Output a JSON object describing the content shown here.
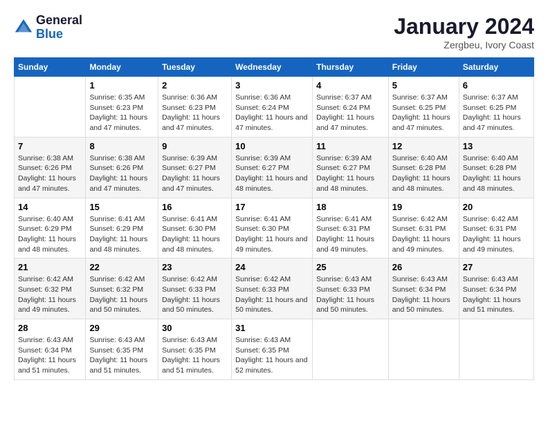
{
  "logo": {
    "line1": "General",
    "line2": "Blue"
  },
  "title": "January 2024",
  "subtitle": "Zergbeu, Ivory Coast",
  "days_of_week": [
    "Sunday",
    "Monday",
    "Tuesday",
    "Wednesday",
    "Thursday",
    "Friday",
    "Saturday"
  ],
  "weeks": [
    [
      {
        "day": "",
        "sunrise": "",
        "sunset": "",
        "daylight": ""
      },
      {
        "day": "1",
        "sunrise": "Sunrise: 6:35 AM",
        "sunset": "Sunset: 6:23 PM",
        "daylight": "Daylight: 11 hours and 47 minutes."
      },
      {
        "day": "2",
        "sunrise": "Sunrise: 6:36 AM",
        "sunset": "Sunset: 6:23 PM",
        "daylight": "Daylight: 11 hours and 47 minutes."
      },
      {
        "day": "3",
        "sunrise": "Sunrise: 6:36 AM",
        "sunset": "Sunset: 6:24 PM",
        "daylight": "Daylight: 11 hours and 47 minutes."
      },
      {
        "day": "4",
        "sunrise": "Sunrise: 6:37 AM",
        "sunset": "Sunset: 6:24 PM",
        "daylight": "Daylight: 11 hours and 47 minutes."
      },
      {
        "day": "5",
        "sunrise": "Sunrise: 6:37 AM",
        "sunset": "Sunset: 6:25 PM",
        "daylight": "Daylight: 11 hours and 47 minutes."
      },
      {
        "day": "6",
        "sunrise": "Sunrise: 6:37 AM",
        "sunset": "Sunset: 6:25 PM",
        "daylight": "Daylight: 11 hours and 47 minutes."
      }
    ],
    [
      {
        "day": "7",
        "sunrise": "Sunrise: 6:38 AM",
        "sunset": "Sunset: 6:26 PM",
        "daylight": "Daylight: 11 hours and 47 minutes."
      },
      {
        "day": "8",
        "sunrise": "Sunrise: 6:38 AM",
        "sunset": "Sunset: 6:26 PM",
        "daylight": "Daylight: 11 hours and 47 minutes."
      },
      {
        "day": "9",
        "sunrise": "Sunrise: 6:39 AM",
        "sunset": "Sunset: 6:27 PM",
        "daylight": "Daylight: 11 hours and 47 minutes."
      },
      {
        "day": "10",
        "sunrise": "Sunrise: 6:39 AM",
        "sunset": "Sunset: 6:27 PM",
        "daylight": "Daylight: 11 hours and 48 minutes."
      },
      {
        "day": "11",
        "sunrise": "Sunrise: 6:39 AM",
        "sunset": "Sunset: 6:27 PM",
        "daylight": "Daylight: 11 hours and 48 minutes."
      },
      {
        "day": "12",
        "sunrise": "Sunrise: 6:40 AM",
        "sunset": "Sunset: 6:28 PM",
        "daylight": "Daylight: 11 hours and 48 minutes."
      },
      {
        "day": "13",
        "sunrise": "Sunrise: 6:40 AM",
        "sunset": "Sunset: 6:28 PM",
        "daylight": "Daylight: 11 hours and 48 minutes."
      }
    ],
    [
      {
        "day": "14",
        "sunrise": "Sunrise: 6:40 AM",
        "sunset": "Sunset: 6:29 PM",
        "daylight": "Daylight: 11 hours and 48 minutes."
      },
      {
        "day": "15",
        "sunrise": "Sunrise: 6:41 AM",
        "sunset": "Sunset: 6:29 PM",
        "daylight": "Daylight: 11 hours and 48 minutes."
      },
      {
        "day": "16",
        "sunrise": "Sunrise: 6:41 AM",
        "sunset": "Sunset: 6:30 PM",
        "daylight": "Daylight: 11 hours and 48 minutes."
      },
      {
        "day": "17",
        "sunrise": "Sunrise: 6:41 AM",
        "sunset": "Sunset: 6:30 PM",
        "daylight": "Daylight: 11 hours and 49 minutes."
      },
      {
        "day": "18",
        "sunrise": "Sunrise: 6:41 AM",
        "sunset": "Sunset: 6:31 PM",
        "daylight": "Daylight: 11 hours and 49 minutes."
      },
      {
        "day": "19",
        "sunrise": "Sunrise: 6:42 AM",
        "sunset": "Sunset: 6:31 PM",
        "daylight": "Daylight: 11 hours and 49 minutes."
      },
      {
        "day": "20",
        "sunrise": "Sunrise: 6:42 AM",
        "sunset": "Sunset: 6:31 PM",
        "daylight": "Daylight: 11 hours and 49 minutes."
      }
    ],
    [
      {
        "day": "21",
        "sunrise": "Sunrise: 6:42 AM",
        "sunset": "Sunset: 6:32 PM",
        "daylight": "Daylight: 11 hours and 49 minutes."
      },
      {
        "day": "22",
        "sunrise": "Sunrise: 6:42 AM",
        "sunset": "Sunset: 6:32 PM",
        "daylight": "Daylight: 11 hours and 50 minutes."
      },
      {
        "day": "23",
        "sunrise": "Sunrise: 6:42 AM",
        "sunset": "Sunset: 6:33 PM",
        "daylight": "Daylight: 11 hours and 50 minutes."
      },
      {
        "day": "24",
        "sunrise": "Sunrise: 6:42 AM",
        "sunset": "Sunset: 6:33 PM",
        "daylight": "Daylight: 11 hours and 50 minutes."
      },
      {
        "day": "25",
        "sunrise": "Sunrise: 6:43 AM",
        "sunset": "Sunset: 6:33 PM",
        "daylight": "Daylight: 11 hours and 50 minutes."
      },
      {
        "day": "26",
        "sunrise": "Sunrise: 6:43 AM",
        "sunset": "Sunset: 6:34 PM",
        "daylight": "Daylight: 11 hours and 50 minutes."
      },
      {
        "day": "27",
        "sunrise": "Sunrise: 6:43 AM",
        "sunset": "Sunset: 6:34 PM",
        "daylight": "Daylight: 11 hours and 51 minutes."
      }
    ],
    [
      {
        "day": "28",
        "sunrise": "Sunrise: 6:43 AM",
        "sunset": "Sunset: 6:34 PM",
        "daylight": "Daylight: 11 hours and 51 minutes."
      },
      {
        "day": "29",
        "sunrise": "Sunrise: 6:43 AM",
        "sunset": "Sunset: 6:35 PM",
        "daylight": "Daylight: 11 hours and 51 minutes."
      },
      {
        "day": "30",
        "sunrise": "Sunrise: 6:43 AM",
        "sunset": "Sunset: 6:35 PM",
        "daylight": "Daylight: 11 hours and 51 minutes."
      },
      {
        "day": "31",
        "sunrise": "Sunrise: 6:43 AM",
        "sunset": "Sunset: 6:35 PM",
        "daylight": "Daylight: 11 hours and 52 minutes."
      },
      {
        "day": "",
        "sunrise": "",
        "sunset": "",
        "daylight": ""
      },
      {
        "day": "",
        "sunrise": "",
        "sunset": "",
        "daylight": ""
      },
      {
        "day": "",
        "sunrise": "",
        "sunset": "",
        "daylight": ""
      }
    ]
  ]
}
